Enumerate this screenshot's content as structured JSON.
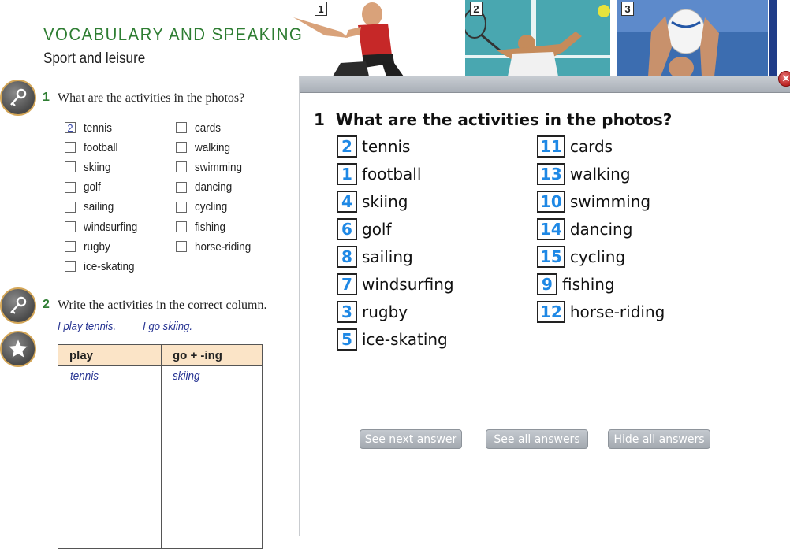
{
  "book": {
    "title": "VOCABULARY AND SPEAKING",
    "subtitle": "Sport and leisure"
  },
  "photos": [
    {
      "number": "1",
      "subject": "footballer kicking"
    },
    {
      "number": "2",
      "subject": "tennis player"
    },
    {
      "number": "3",
      "subject": "rugby player with ball"
    }
  ],
  "exercise1": {
    "number": "1",
    "prompt": "What are the activities in the photos?",
    "col1": [
      {
        "label": "tennis",
        "mark": "2"
      },
      {
        "label": "football",
        "mark": ""
      },
      {
        "label": "skiing",
        "mark": ""
      },
      {
        "label": "golf",
        "mark": ""
      },
      {
        "label": "sailing",
        "mark": ""
      },
      {
        "label": "windsurfing",
        "mark": ""
      },
      {
        "label": "rugby",
        "mark": ""
      },
      {
        "label": "ice-skating",
        "mark": ""
      }
    ],
    "col2": [
      {
        "label": "cards",
        "mark": ""
      },
      {
        "label": "walking",
        "mark": ""
      },
      {
        "label": "swimming",
        "mark": ""
      },
      {
        "label": "dancing",
        "mark": ""
      },
      {
        "label": "cycling",
        "mark": ""
      },
      {
        "label": "fishing",
        "mark": ""
      },
      {
        "label": "horse-riding",
        "mark": ""
      }
    ]
  },
  "exercise2": {
    "number": "2",
    "prompt": "Write the activities in the correct column.",
    "example1": "I play tennis.",
    "example2": "I go skiing.",
    "table": {
      "head_play": "play",
      "head_go": "go + -ing",
      "entry_play": "tennis",
      "entry_go": "skiing"
    }
  },
  "side_buttons": {
    "icons": [
      "key-icon",
      "key-icon",
      "star-icon"
    ]
  },
  "answer_panel": {
    "title": "1  What are the activities in the photos?",
    "col1": [
      {
        "num": "2",
        "label": "tennis"
      },
      {
        "num": "1",
        "label": "football"
      },
      {
        "num": "4",
        "label": "skiing"
      },
      {
        "num": "6",
        "label": "golf"
      },
      {
        "num": "8",
        "label": "sailing"
      },
      {
        "num": "7",
        "label": "windsurfing"
      },
      {
        "num": "3",
        "label": "rugby"
      },
      {
        "num": "5",
        "label": "ice-skating"
      }
    ],
    "col2": [
      {
        "num": "11",
        "label": "cards"
      },
      {
        "num": "13",
        "label": "walking"
      },
      {
        "num": "10",
        "label": "swimming"
      },
      {
        "num": "14",
        "label": "dancing"
      },
      {
        "num": "15",
        "label": "cycling"
      },
      {
        "num": "9",
        "label": "fishing"
      },
      {
        "num": "12",
        "label": "horse-riding"
      }
    ],
    "buttons": {
      "next": "See next answer",
      "all": "See all answers",
      "hide": "Hide all answers"
    },
    "close_icon": "close-icon"
  },
  "colors": {
    "title_green": "#2e7d32",
    "answer_blue": "#1e88e5",
    "handwriting_blue": "#283593",
    "table_header": "#fbe4c7"
  }
}
